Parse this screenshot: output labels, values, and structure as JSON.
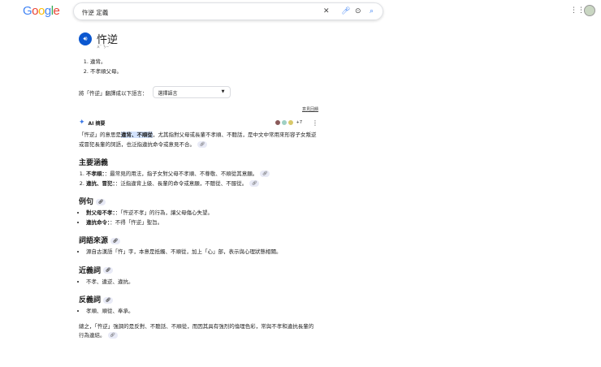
{
  "header": {
    "logo": "Google",
    "query": "忤逆 定義"
  },
  "entry": {
    "word": "忤逆",
    "phonetic": "ㄨˇ ㄋㄧˋ",
    "definitions": [
      "違背。",
      "不孝順父母。"
    ],
    "translate_label": "將「忤逆」翻譯成以下語言：",
    "translate_select": "選擇語言",
    "feedback": "意見回饋"
  },
  "ai": {
    "label": "AI 摘要",
    "source_count": "+7",
    "intro_a": "「忤逆」的意思是",
    "intro_hl": "違背、不順從",
    "intro_b": "，尤其指對父母或長輩不孝順、不聽話，是中文中常用來形容子女叛逆或冒犯長輩的詞語，也泛指違抗命令或意見不合。",
    "s1": {
      "title": "主要涵義",
      "items": [
        {
          "term": "不孝順：",
          "text": "：最常見的用法，指子女對父母不孝順、不尊敬、不順從其意願。"
        },
        {
          "term": "違抗、冒犯：",
          "text": "：泛指違背上級、長輩的命令或意願，不聽從、不服從。"
        }
      ]
    },
    "s2": {
      "title": "例句",
      "items": [
        {
          "term": "對父母不孝：",
          "text": "：「忤逆不孝」的行為，讓父母傷心失望。"
        },
        {
          "term": "違抗命令：",
          "text": "：不得「忤逆」聖旨。"
        }
      ]
    },
    "s3": {
      "title": "詞語來源",
      "items": [
        "源自古漢語「忤」字，本意是抵觸、不順從，加上「心」部，表示與心理狀態相關。"
      ]
    },
    "s4": {
      "title": "近義詞",
      "items": [
        "不孝、違逆、違抗。"
      ]
    },
    "s5": {
      "title": "反義詞",
      "items": [
        "孝順、順從、奉承。"
      ]
    },
    "summary": "總之，「忤逆」強調的是反對、不聽話、不順從，而因其具有強烈的倫理色彩，常與不孝和違抗長輩的行為連結。"
  }
}
